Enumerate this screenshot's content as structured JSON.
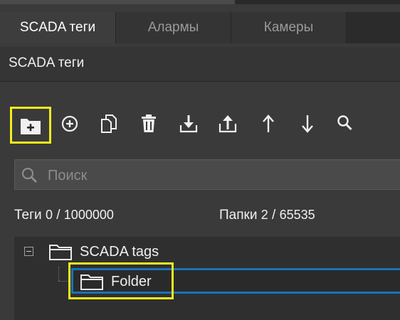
{
  "tabs": [
    {
      "label": "SCADA теги",
      "active": true
    },
    {
      "label": "Алармы",
      "active": false
    },
    {
      "label": "Камеры",
      "active": false
    }
  ],
  "panel": {
    "title": "SCADA теги"
  },
  "toolbar": [
    {
      "icon": "add-folder-icon",
      "highlighted": true
    },
    {
      "icon": "add-circle-icon"
    },
    {
      "icon": "copy-icon"
    },
    {
      "icon": "trash-icon"
    },
    {
      "icon": "import-icon"
    },
    {
      "icon": "export-icon"
    },
    {
      "icon": "arrow-up-icon"
    },
    {
      "icon": "arrow-down-icon"
    },
    {
      "icon": "search-icon"
    }
  ],
  "search": {
    "placeholder": "Поиск",
    "value": ""
  },
  "stats": {
    "tags_label": "Теги",
    "tags_count": "0",
    "tags_max": "1000000",
    "folders_label": "Папки",
    "folders_count": "2",
    "folders_max": "65535",
    "separator": "/"
  },
  "tree": {
    "root": {
      "label": "SCADA tags",
      "expanded": true
    },
    "children": [
      {
        "label": "Folder",
        "selected": true,
        "highlighted": true
      }
    ]
  },
  "colors": {
    "highlight": "#f5ec1c",
    "selection": "#1a73b8",
    "background": "#3a3a3a"
  }
}
